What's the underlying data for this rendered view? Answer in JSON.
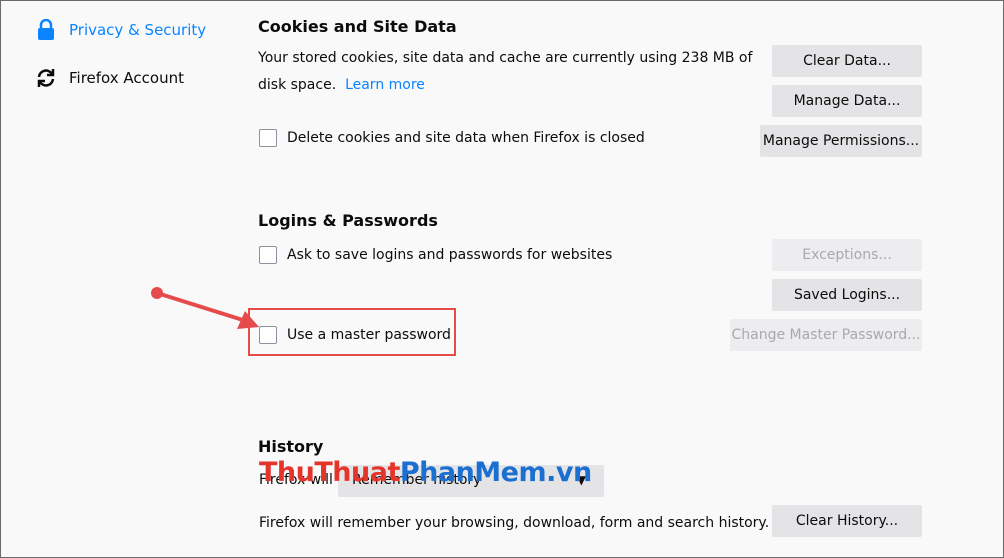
{
  "sidebar": {
    "items": [
      {
        "label": "Privacy & Security",
        "icon": "lock-icon",
        "active": true
      },
      {
        "label": "Firefox Account",
        "icon": "sync-icon",
        "active": false
      }
    ]
  },
  "cookies": {
    "heading": "Cookies and Site Data",
    "description": "Your stored cookies, site data and cache are currently using 238 MB of disk space.",
    "learn_more": "Learn more",
    "clear_data": "Clear Data...",
    "manage_data": "Manage Data...",
    "delete_on_close": "Delete cookies and site data when Firefox is closed",
    "manage_permissions": "Manage Permissions..."
  },
  "logins": {
    "heading": "Logins & Passwords",
    "ask_to_save": "Ask to save logins and passwords for websites",
    "exceptions": "Exceptions...",
    "saved_logins": "Saved Logins...",
    "master_password": "Use a master password",
    "change_master": "Change Master Password..."
  },
  "history": {
    "heading": "History",
    "firefox_will_prefix": "Firefox will",
    "select_value": "Remember history",
    "description": "Firefox will remember your browsing, download, form and search history.",
    "clear_history": "Clear History..."
  },
  "watermark": {
    "part1": "ThuThuat",
    "part2": "PhanMem",
    "part3": ".vn"
  },
  "colors": {
    "accent": "#0a84ff",
    "annotation": "#e54b4b"
  }
}
